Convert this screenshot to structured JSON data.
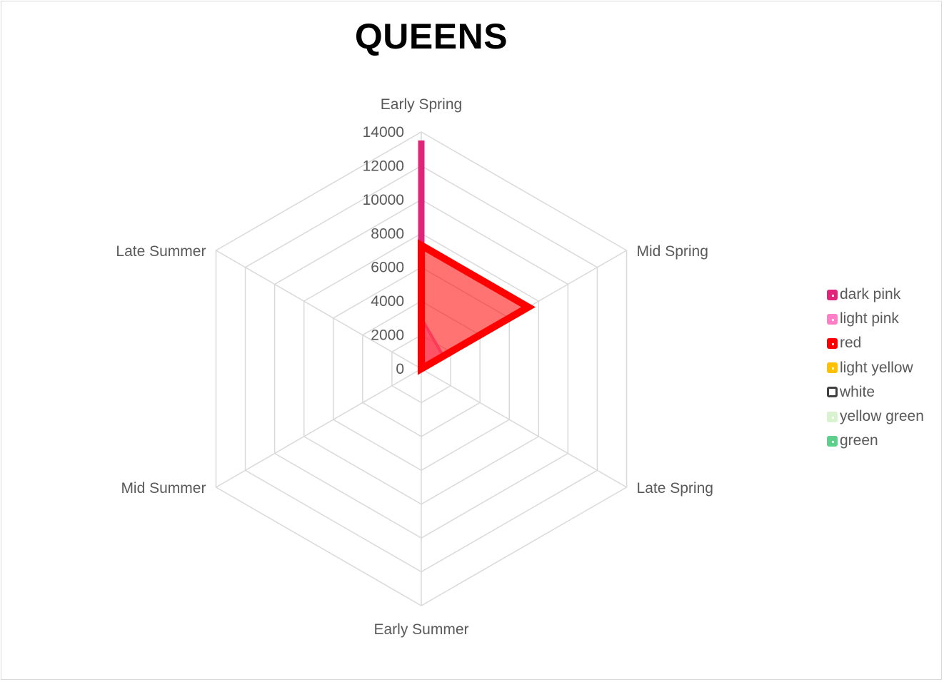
{
  "chart_data": {
    "type": "radar",
    "title": "QUEENS",
    "categories": [
      "Early Spring",
      "Mid Spring",
      "Late Spring",
      "Early Summer",
      "Mid Summer",
      "Late Summer"
    ],
    "rlim": [
      0,
      14000
    ],
    "ticks": [
      "0",
      "2000",
      "4000",
      "6000",
      "8000",
      "10000",
      "12000",
      "14000"
    ],
    "legend_position": "right",
    "series": [
      {
        "name": "dark pink",
        "color": "#e0247a",
        "values": [
          13500,
          0,
          0,
          0,
          0,
          0
        ]
      },
      {
        "name": "light pink",
        "color": "#ff7fc6",
        "values": [
          3000,
          1500,
          0,
          0,
          0,
          0
        ]
      },
      {
        "name": "red",
        "color": "#ff0000",
        "values": [
          7300,
          7300,
          0,
          0,
          0,
          0
        ]
      },
      {
        "name": "light yellow",
        "color": "#ffc000",
        "values": [
          0,
          0,
          0,
          0,
          0,
          0
        ]
      },
      {
        "name": "white",
        "color": "#404040",
        "values": [
          0,
          0,
          0,
          0,
          0,
          0
        ]
      },
      {
        "name": "yellow green",
        "color": "#d9f2d0",
        "values": [
          0,
          0,
          0,
          0,
          0,
          0
        ]
      },
      {
        "name": "green",
        "color": "#5ccf8a",
        "values": [
          0,
          0,
          0,
          0,
          0,
          0
        ]
      }
    ]
  }
}
